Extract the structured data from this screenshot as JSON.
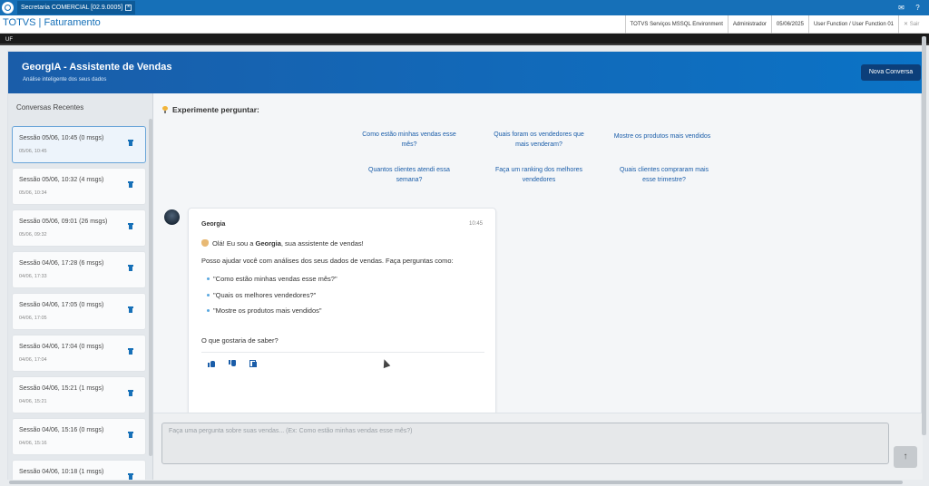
{
  "titlebar": {
    "tab_label": "Secretaria COMERCIAL [02.9.0005]",
    "tab_close": "×",
    "icons": [
      "mail-icon",
      "help-icon"
    ]
  },
  "header": {
    "app_title": "TOTVS | Faturamento",
    "environment": "TOTVS Serviços MSSQL Environment",
    "user": "Administrador",
    "date": "05/06/2025",
    "function": "User Function / User Function 01",
    "exit": "Sair"
  },
  "ufbar": {
    "label": "UF"
  },
  "banner": {
    "title": "GeorgIA - Assistente de Vendas",
    "subtitle": "Análise inteligente dos seus dados",
    "new_conversation": "Nova Conversa"
  },
  "sidebar": {
    "title": "Conversas Recentes",
    "sessions": [
      {
        "title": "Sessão 05/06, 10:45 (0 msgs)",
        "date": "05/06, 10:45",
        "active": true
      },
      {
        "title": "Sessão 05/06, 10:32 (4 msgs)",
        "date": "05/06, 10:34"
      },
      {
        "title": "Sessão 05/06, 09:01 (26 msgs)",
        "date": "05/06, 09:32"
      },
      {
        "title": "Sessão 04/06, 17:28 (6 msgs)",
        "date": "04/06, 17:33"
      },
      {
        "title": "Sessão 04/06, 17:05 (0 msgs)",
        "date": "04/06, 17:05"
      },
      {
        "title": "Sessão 04/06, 17:04 (0 msgs)",
        "date": "04/06, 17:04"
      },
      {
        "title": "Sessão 04/06, 15:21 (1 msgs)",
        "date": "04/06, 15:21"
      },
      {
        "title": "Sessão 04/06, 15:16 (0 msgs)",
        "date": "04/06, 15:16"
      },
      {
        "title": "Sessão 04/06, 10:18 (1 msgs)",
        "date": ""
      }
    ]
  },
  "suggestions": {
    "title": "Experimente perguntar:",
    "items": [
      {
        "line1": "Como estão minhas vendas esse",
        "line2": "mês?"
      },
      {
        "line1": "Quais foram os vendedores que",
        "line2": "mais venderam?"
      },
      {
        "line1": "Mostre os produtos mais vendidos",
        "line2": ""
      },
      {
        "line1": "Quantos clientes atendi essa",
        "line2": "semana?"
      },
      {
        "line1": "Faça um ranking dos melhores",
        "line2": "vendedores"
      },
      {
        "line1": "Quais clientes compraram mais",
        "line2": "esse trimestre?"
      }
    ]
  },
  "message": {
    "sender": "Georgia",
    "time": "10:45",
    "greeting_pre": "Olá! Eu sou a ",
    "greeting_name": "Georgia",
    "greeting_post": ", sua assistente de vendas!",
    "intro": "Posso ajudar você com análises dos seus dados de vendas. Faça perguntas como:",
    "examples": [
      "\"Como estão minhas vendas esse mês?\"",
      "\"Quais os melhores vendedores?\"",
      "\"Mostre os produtos mais vendidos\""
    ],
    "closing": "O que gostaria de saber?"
  },
  "composer": {
    "placeholder": "Faça uma pergunta sobre suas vendas... (Ex: Como estão minhas vendas esse mês?)",
    "send": "↑"
  }
}
